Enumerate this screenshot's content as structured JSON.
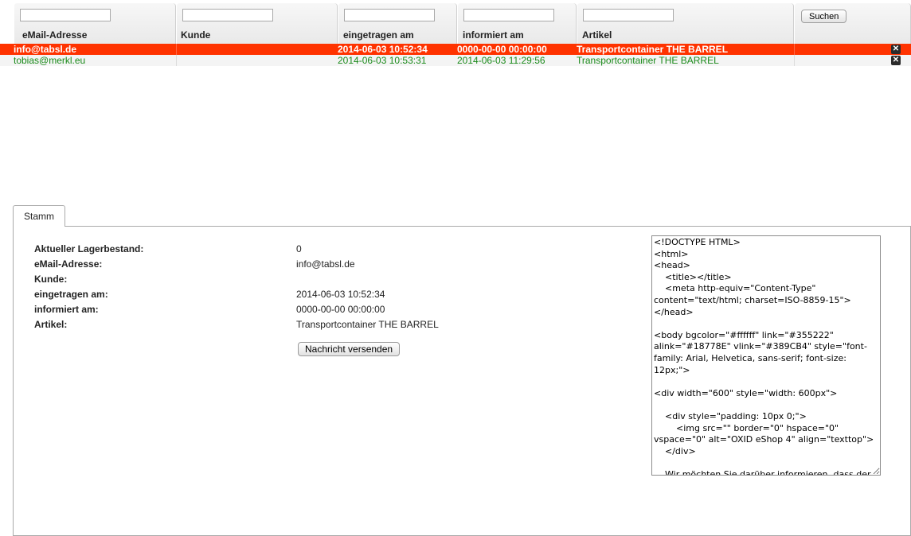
{
  "list": {
    "columns": [
      "eMail-Adresse",
      "Kunde",
      "eingetragen am",
      "informiert am",
      "Artikel"
    ],
    "filters": [
      "",
      "",
      "",
      "",
      ""
    ],
    "search_label": "Suchen",
    "rows": [
      {
        "email": "info@tabsl.de",
        "kunde": "",
        "eingetragen": "2014-06-03 10:52:34",
        "informiert": "0000-00-00 00:00:00",
        "artikel": "Transportcontainer THE BARREL",
        "selected": true
      },
      {
        "email": "tobias@merkl.eu",
        "kunde": "",
        "eingetragen": "2014-06-03 10:53:31",
        "informiert": "2014-06-03 11:29:56",
        "artikel": "Transportcontainer THE BARREL",
        "selected": false
      }
    ],
    "delete_icon": "close-icon",
    "colors": {
      "selected_row": "#ff3300",
      "notified_text": "#1a8a1a"
    }
  },
  "detail": {
    "tab_label": "Stamm",
    "fields": {
      "stock_label": "Aktueller Lagerbestand:",
      "stock_value": "0",
      "email_label": "eMail-Adresse:",
      "email_value": "info@tabsl.de",
      "customer_label": "Kunde:",
      "customer_value": "",
      "registered_label": "eingetragen am:",
      "registered_value": "2014-06-03 10:52:34",
      "notified_label": "informiert am:",
      "notified_value": "0000-00-00 00:00:00",
      "article_label": "Artikel:",
      "article_value": "Transportcontainer THE BARREL"
    },
    "send_button_label": "Nachricht versenden",
    "mail_source": "<!DOCTYPE HTML>\n<html>\n<head>\n    <title></title>\n    <meta http-equiv=\"Content-Type\" content=\"text/html; charset=ISO-8859-15\">\n</head>\n\n<body bgcolor=\"#ffffff\" link=\"#355222\" alink=\"#18778E\" vlink=\"#389CB4\" style=\"font-family: Arial, Helvetica, sans-serif; font-size: 12px;\">\n\n<div width=\"600\" style=\"width: 600px\">\n\n    <div style=\"padding: 10px 0;\">\n        <img src=\"\" border=\"0\" hspace=\"0\" vspace=\"0\" alt=\"OXID eShop 4\" align=\"texttop\">\n    </div>\n\n    Wir möchten Sie darüber informieren, dass der Artikel <b>Transportcontainer THE BARREL</b> wieder lieferbar ist."
  }
}
